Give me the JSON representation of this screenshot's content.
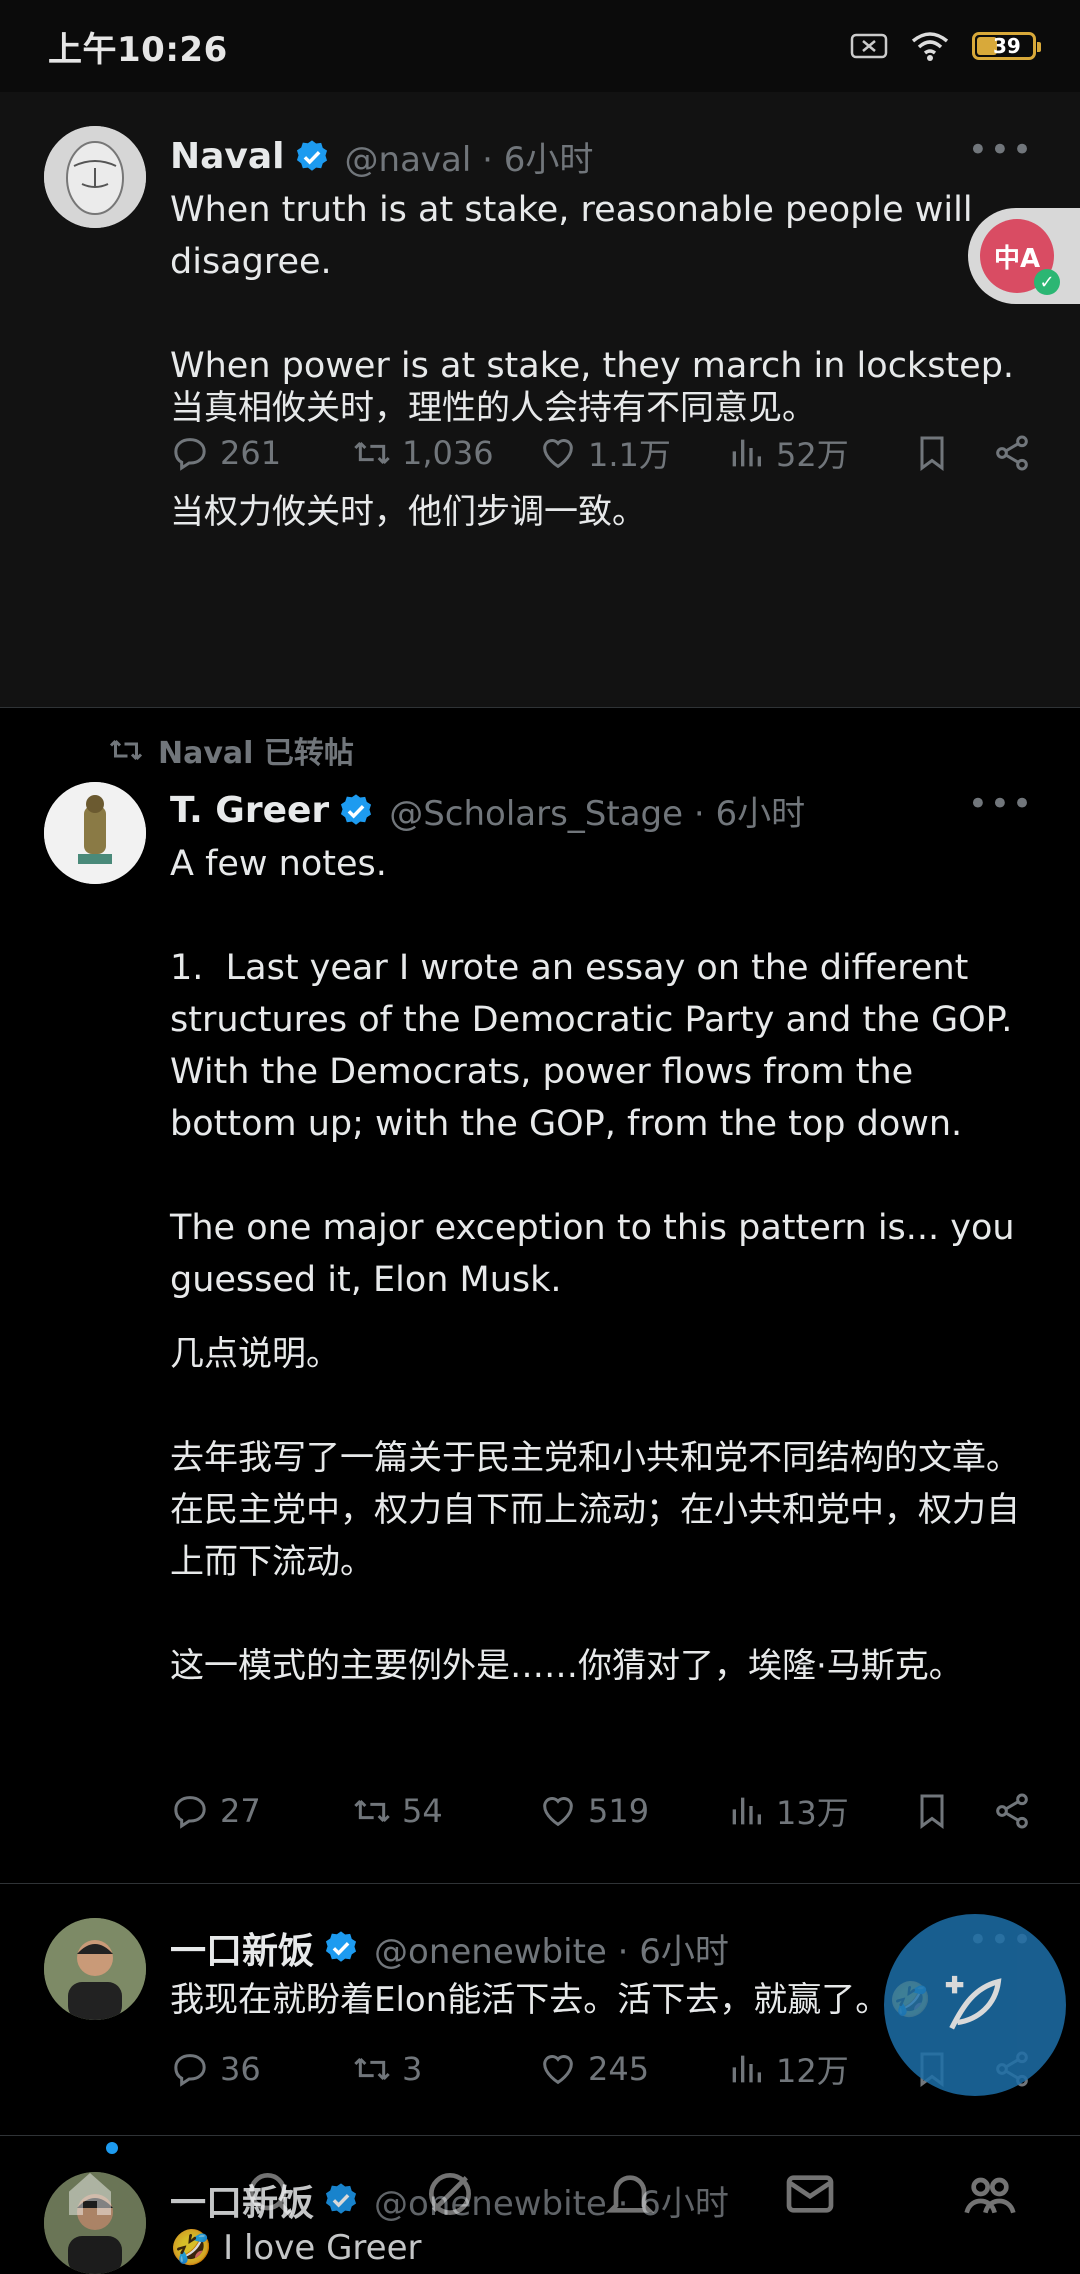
{
  "status_bar": {
    "time": "上午10:26",
    "battery": "39"
  },
  "tweets": [
    {
      "name": "Naval",
      "handle": "@naval · 6小时",
      "text": "When truth is at stake, reasonable people will disagree.\n\nWhen power is at stake, they march in lockstep.",
      "translation": "当真相攸关时，理性的人会持有不同意见。\n\n当权力攸关时，他们步调一致。",
      "replies": "261",
      "retweets": "1,036",
      "likes": "1.1万",
      "views": "52万"
    },
    {
      "retweeted_by": "Naval 已转帖",
      "name": "T. Greer",
      "handle": "@Scholars_Stage · 6小时",
      "text": "A few notes.\n\n1.  Last year I wrote an essay on the different structures of the Democratic Party and the GOP. With the Democrats, power flows from the bottom up; with the GOP, from the top down.\n\nThe one major exception to this pattern is... you guessed it, Elon Musk.",
      "translation": "几点说明。\n\n去年我写了一篇关于民主党和小共和党不同结构的文章。在民主党中，权力自下而上流动；在小共和党中，权力自上而下流动。\n\n这一模式的主要例外是……你猜对了，埃隆·马斯克。",
      "replies": "27",
      "retweets": "54",
      "likes": "519",
      "views": "13万"
    },
    {
      "name": "一口新饭",
      "handle": "@onenewbite · 6小时",
      "text": "我现在就盼着Elon能活下去。活下去，就赢了。🤣",
      "replies": "36",
      "retweets": "3",
      "likes": "245",
      "views": "12万"
    },
    {
      "name": "一口新饭",
      "handle": "@onenewbite · 6小时",
      "text": "🤣 I love Greer"
    }
  ],
  "translate_badge": {
    "label": "中A"
  },
  "icons": {
    "reply": "reply-icon",
    "retweet": "retweet-icon",
    "like": "heart-icon",
    "views": "views-icon",
    "bookmark": "bookmark-icon",
    "share": "share-icon"
  },
  "accent": "#1d9bf0"
}
